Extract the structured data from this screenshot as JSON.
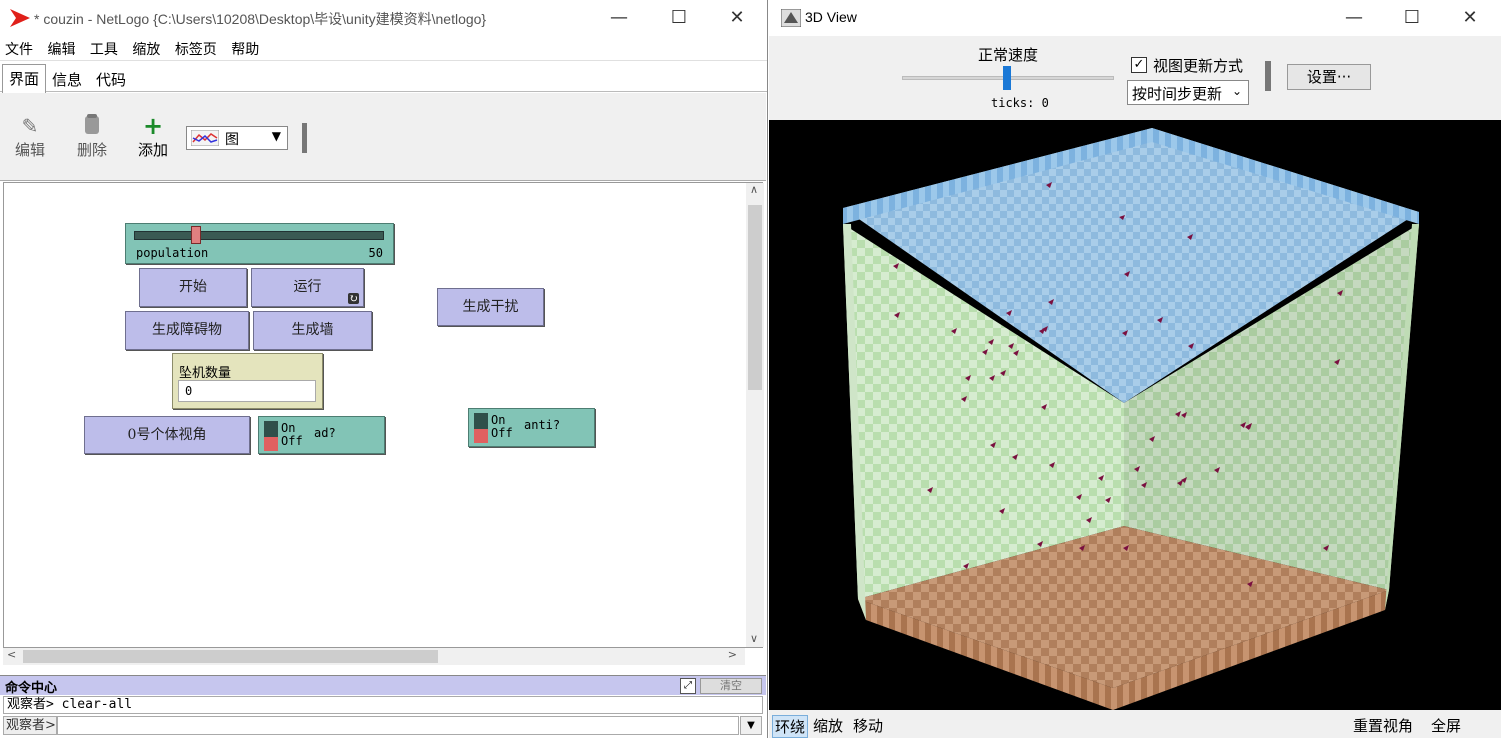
{
  "left_window": {
    "title": "* couzin - NetLogo {C:\\Users\\10208\\Desktop\\毕设\\unity建模资料\\netlogo}",
    "window_buttons": {
      "min": "—",
      "max": "☐",
      "close": "✕"
    },
    "menu": [
      "文件",
      "编辑",
      "工具",
      "缩放",
      "标签页",
      "帮助"
    ],
    "tabs": [
      "界面",
      "信息",
      "代码"
    ],
    "toolbar": {
      "edit_label": "编辑",
      "delete_label": "删除",
      "add_label": "添加",
      "widget_type": "图"
    },
    "widgets": {
      "slider": {
        "label": "population",
        "value": "50",
        "fraction": 0.26
      },
      "buttons": {
        "start": "开始",
        "run": "运行",
        "gen_obstacle": "生成障碍物",
        "gen_wall": "生成墙",
        "gen_disturb": "生成干扰",
        "view_agent0": "0号个体视角"
      },
      "monitor": {
        "label": "坠机数量",
        "value": "0"
      },
      "switch_ad": {
        "on": "On",
        "off": "Off",
        "name": "ad?"
      },
      "switch_anti": {
        "on": "On",
        "off": "Off",
        "name": "anti?"
      }
    },
    "command_center": {
      "title": "命令中心",
      "clear_label": "清空",
      "output_line": "观察者> clear-all",
      "observer_label": "观察者>"
    }
  },
  "right_window": {
    "title": "3D View",
    "window_buttons": {
      "min": "—",
      "max": "☐",
      "close": "✕"
    },
    "speed_label": "正常速度",
    "ticks_label": "ticks: 0",
    "update_checkbox_label": "视图更新方式",
    "update_mode": "按时间步更新",
    "settings_label": "设置···",
    "footer": {
      "orbit": "环绕",
      "zoom": "缩放",
      "move": "移动",
      "reset": "重置视角",
      "fullscreen": "全屏"
    }
  },
  "colors": {
    "button_bg": "#bdbdea",
    "slider_bg": "#82c4b6",
    "monitor_bg": "#e4e4bd",
    "wall_green": "#cfe8c6",
    "ceiling_blue": "#8fbde0",
    "floor_brown": "#b98a66"
  }
}
